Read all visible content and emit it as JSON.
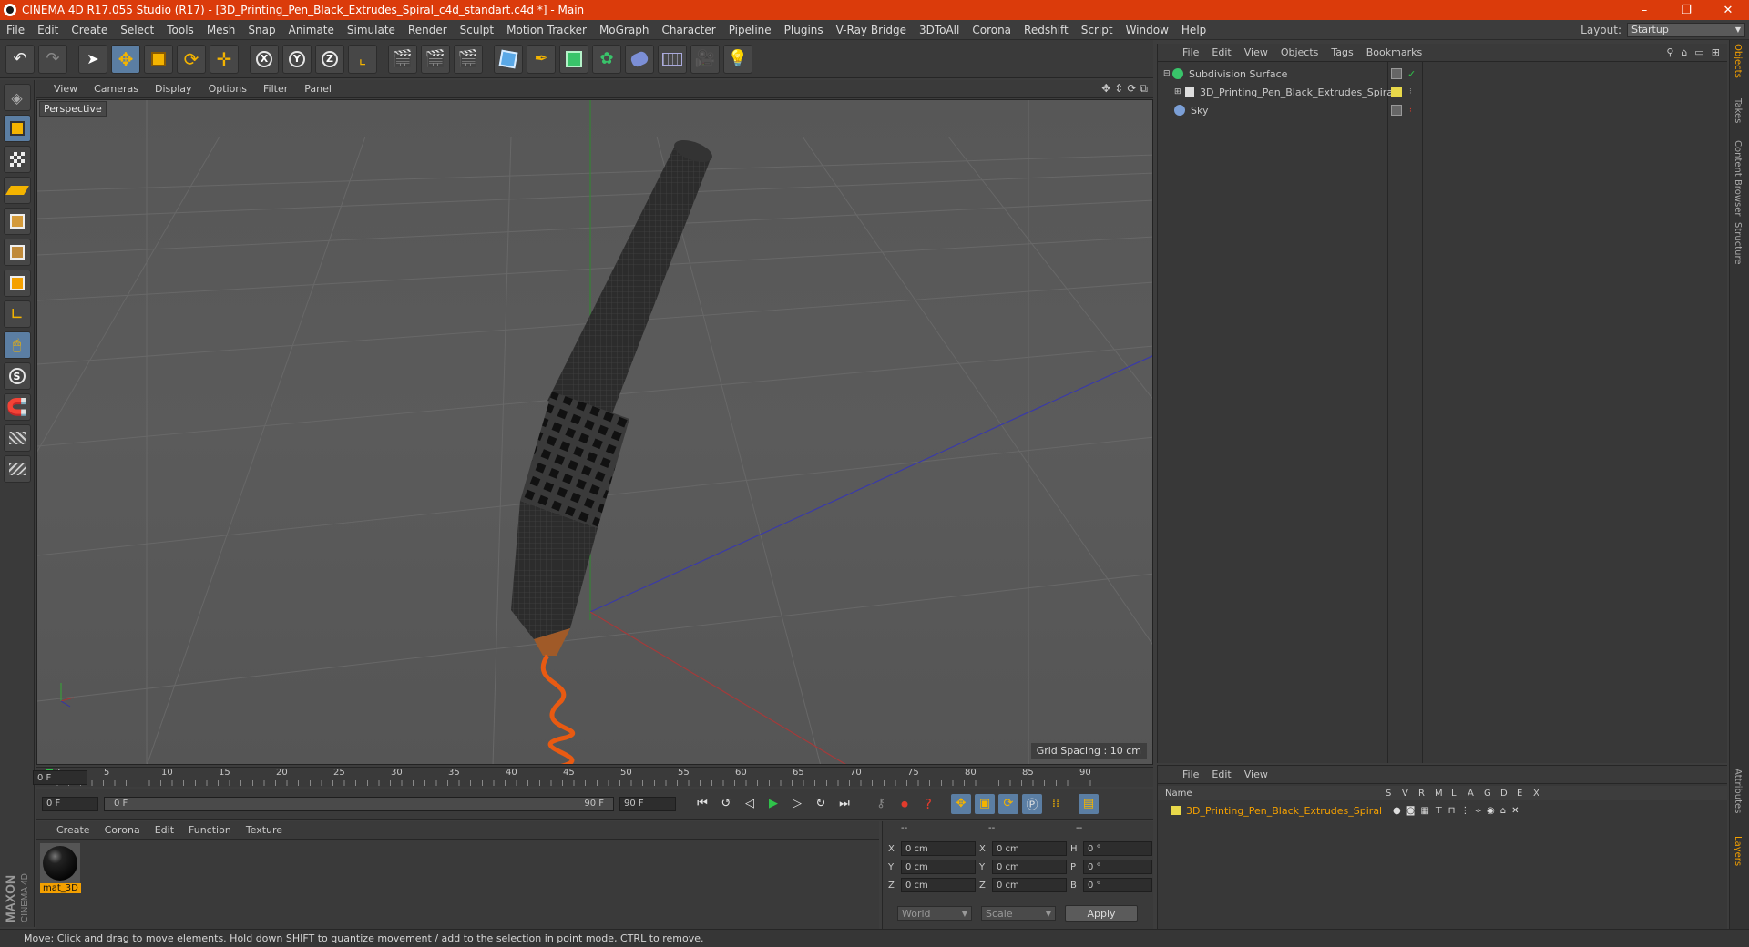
{
  "window": {
    "title": "CINEMA 4D R17.055 Studio (R17) - [3D_Printing_Pen_Black_Extrudes_Spiral_c4d_standart.c4d *] - Main",
    "controls": [
      "–",
      "❐",
      "✕"
    ]
  },
  "menubar": {
    "items": [
      "File",
      "Edit",
      "Create",
      "Select",
      "Tools",
      "Mesh",
      "Snap",
      "Animate",
      "Simulate",
      "Render",
      "Sculpt",
      "Motion Tracker",
      "MoGraph",
      "Character",
      "Pipeline",
      "Plugins",
      "V-Ray Bridge",
      "3DToAll",
      "Corona",
      "Redshift",
      "Script",
      "Window",
      "Help"
    ],
    "layout_label": "Layout:",
    "layout_value": "Startup"
  },
  "toolbar": {
    "axis_labels": [
      "X",
      "Y",
      "Z"
    ]
  },
  "viewport": {
    "menu": [
      "View",
      "Cameras",
      "Display",
      "Options",
      "Filter",
      "Panel"
    ],
    "label": "Perspective",
    "grid_spacing": "Grid Spacing : 10 cm"
  },
  "timeline": {
    "ticks": [
      "0",
      "5",
      "10",
      "15",
      "20",
      "25",
      "30",
      "35",
      "40",
      "45",
      "50",
      "55",
      "60",
      "65",
      "70",
      "75",
      "80",
      "85",
      "90"
    ],
    "current_frame": "0 F"
  },
  "transport": {
    "start": "0 F",
    "range_start": "0 F",
    "range_end": "90 F",
    "end": "90 F"
  },
  "material_manager": {
    "menu": [
      "Create",
      "Corona",
      "Edit",
      "Function",
      "Texture"
    ],
    "materials": [
      {
        "name": "mat_3D"
      }
    ]
  },
  "coordinates": {
    "headers": [
      "--",
      "--",
      "--"
    ],
    "rows": [
      {
        "l1": "X",
        "v1": "0 cm",
        "l2": "X",
        "v2": "0 cm",
        "l3": "H",
        "v3": "0 °"
      },
      {
        "l1": "Y",
        "v1": "0 cm",
        "l2": "Y",
        "v2": "0 cm",
        "l3": "P",
        "v3": "0 °"
      },
      {
        "l1": "Z",
        "v1": "0 cm",
        "l2": "Z",
        "v2": "0 cm",
        "l3": "B",
        "v3": "0 °"
      }
    ],
    "mode1": "World",
    "mode2": "Scale",
    "apply": "Apply"
  },
  "object_manager": {
    "menu": [
      "File",
      "Edit",
      "View",
      "Objects",
      "Tags",
      "Bookmarks"
    ],
    "objects": [
      {
        "name": "Subdivision Surface",
        "color": "#39c46a"
      },
      {
        "name": "3D_Printing_Pen_Black_Extrudes_Spiral",
        "color": "#e8e8e8"
      },
      {
        "name": "Sky",
        "color": "#7b9fd6"
      }
    ]
  },
  "layer_manager": {
    "menu": [
      "File",
      "Edit",
      "View"
    ],
    "columns": [
      "Name",
      "S",
      "V",
      "R",
      "M",
      "L",
      "A",
      "G",
      "D",
      "E",
      "X"
    ],
    "layers": [
      {
        "name": "3D_Printing_Pen_Black_Extrudes_Spiral",
        "color": "#e8d84a"
      }
    ]
  },
  "right_tabs": [
    "Objects",
    "Takes",
    "Content Browser",
    "Structure",
    "Attributes",
    "Layers"
  ],
  "status": "Move: Click and drag to move elements. Hold down SHIFT to quantize movement / add to the selection in point mode, CTRL to remove.",
  "colors": {
    "accent": "#db3b0b",
    "highlight": "#f4a000",
    "selection": "#5b7ea3"
  }
}
